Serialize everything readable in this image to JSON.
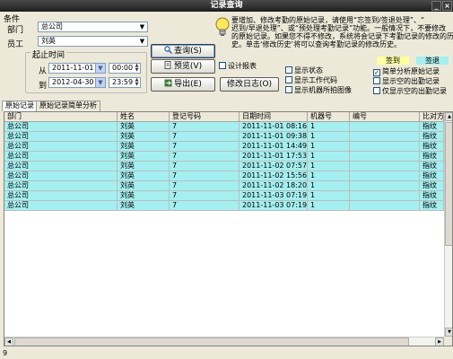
{
  "window": {
    "title": "记录查询",
    "close_label": "×",
    "minimize_label": "_"
  },
  "filter": {
    "group_label": "条件",
    "dept_label": "部门",
    "dept_value": "总公司",
    "staff_label": "员工",
    "staff_value": "刘英",
    "period_label": "起止时间",
    "from_label": "从",
    "from_date": "2011-11-01",
    "from_time": "00:00",
    "to_label": "到",
    "to_date": "2012-04-30",
    "to_time": "23:59"
  },
  "buttons": {
    "query": "查询(S)",
    "preview": "预览(V)",
    "export": "导出(E)",
    "modify_log": "修改日志(O)"
  },
  "checkboxes": [
    {
      "label": "设计报表",
      "checked": false
    },
    {
      "label": "显示状态",
      "checked": false
    },
    {
      "label": "显示工作代码",
      "checked": false
    },
    {
      "label": "显示机器所拍图像",
      "checked": false
    },
    {
      "label": "简单分析原始记录",
      "checked": true
    },
    {
      "label": "显示空的出勤记录",
      "checked": false
    },
    {
      "label": "仅显示空的出勤记录",
      "checked": false
    }
  ],
  "note": {
    "lines": [
      "要增加、修改考勤的原始记录，请使用“忘签到/签退处理”、“",
      "迟到/早退处理”、或“预处理考勤记录”功能。一般情况下，不要修改",
      "的原始记录。如果您不得不修改，系统将会记录下考勤记录的修改的历",
      "史。单击‘修改历史’将可以查询考勤记录的修改历史。"
    ]
  },
  "legend": {
    "signin_label": "签到",
    "signin_color": "#ffffa0",
    "signout_label": "签退",
    "signout_color": "#a4f0f0"
  },
  "tabs": [
    {
      "label": "原始记录",
      "active": true
    },
    {
      "label": "原始记录简单分析",
      "active": false
    }
  ],
  "table": {
    "headers": [
      "部门",
      "姓名",
      "登记号码",
      "日期时间",
      "机器号",
      "编号",
      "比对方式"
    ],
    "rows": [
      [
        "总公司",
        "刘英",
        "7",
        "2011-11-01 08:16:00",
        "1",
        "",
        "指纹"
      ],
      [
        "总公司",
        "刘英",
        "7",
        "2011-11-01 09:38:29",
        "1",
        "",
        "指纹"
      ],
      [
        "总公司",
        "刘英",
        "7",
        "2011-11-01 14:49:23",
        "1",
        "",
        "指纹"
      ],
      [
        "总公司",
        "刘英",
        "7",
        "2011-11-01 17:53:36",
        "1",
        "",
        "指纹"
      ],
      [
        "总公司",
        "刘英",
        "7",
        "2011-11-02 07:57:18",
        "1",
        "",
        "指纹"
      ],
      [
        "总公司",
        "刘英",
        "7",
        "2011-11-02 15:56:07",
        "1",
        "",
        "指纹"
      ],
      [
        "总公司",
        "刘英",
        "7",
        "2011-11-02 18:20:14",
        "1",
        "",
        "指纹"
      ],
      [
        "总公司",
        "刘英",
        "7",
        "2011-11-03 07:19:30",
        "1",
        "",
        "指纹"
      ],
      [
        "总公司",
        "刘英",
        "7",
        "2011-11-03 07:19:31",
        "1",
        "",
        "指纹"
      ]
    ],
    "row_color": "#a4f0f0"
  },
  "status": {
    "count": "9"
  }
}
